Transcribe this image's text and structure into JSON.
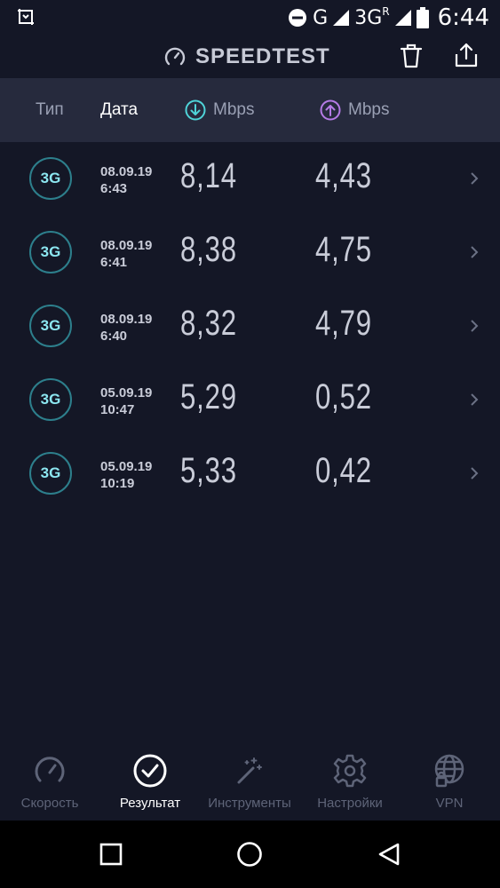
{
  "status_bar": {
    "network_letter": "G",
    "network_type": "3G",
    "roaming_mark": "R",
    "time": "6:44",
    "icons": [
      "screenshot-icon",
      "do-not-disturb-icon",
      "signal-icon",
      "battery-icon"
    ]
  },
  "header": {
    "title": "SPEEDTEST",
    "icons": [
      "speedometer-icon",
      "trash-icon",
      "share-icon"
    ]
  },
  "columns": {
    "type": "Тип",
    "date": "Дата",
    "download": "Mbps",
    "upload": "Mbps"
  },
  "results": [
    {
      "type": "3G",
      "date": "08.09.19",
      "time": "6:43",
      "download": "8,14",
      "upload": "4,43"
    },
    {
      "type": "3G",
      "date": "08.09.19",
      "time": "6:41",
      "download": "8,38",
      "upload": "4,75"
    },
    {
      "type": "3G",
      "date": "08.09.19",
      "time": "6:40",
      "download": "8,32",
      "upload": "4,79"
    },
    {
      "type": "3G",
      "date": "05.09.19",
      "time": "10:47",
      "download": "5,29",
      "upload": "0,52"
    },
    {
      "type": "3G",
      "date": "05.09.19",
      "time": "10:19",
      "download": "5,33",
      "upload": "0,42"
    }
  ],
  "bottom_nav": {
    "speed": "Скорость",
    "results": "Результат",
    "tools": "Инструменты",
    "settings": "Настройки",
    "vpn": "VPN",
    "active": "results"
  },
  "colors": {
    "background": "#141726",
    "header_bar": "#262a3d",
    "download_accent": "#4fd3d8",
    "upload_accent": "#b57be6",
    "badge_ring": "#2d7f8c"
  }
}
